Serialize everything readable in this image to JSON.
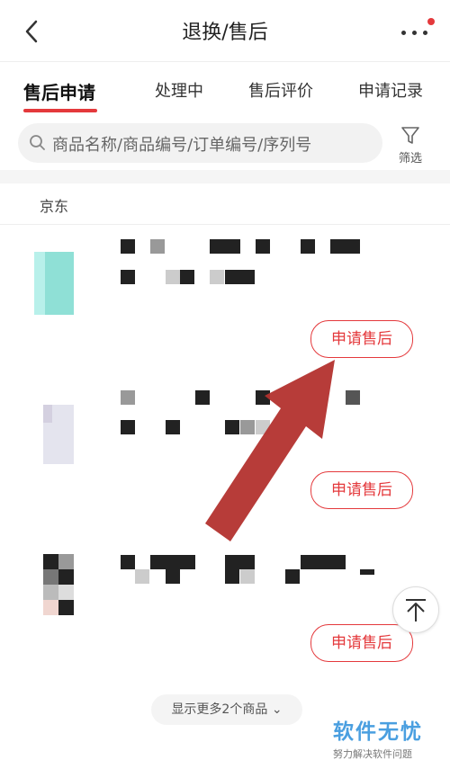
{
  "header": {
    "title": "退换/售后"
  },
  "tabs": [
    {
      "label": "售后申请",
      "active": true
    },
    {
      "label": "处理中"
    },
    {
      "label": "售后评价"
    },
    {
      "label": "申请记录"
    }
  ],
  "search": {
    "placeholder": "商品名称/商品编号/订单编号/序列号",
    "filter_label": "筛选"
  },
  "shop": {
    "name": "京东"
  },
  "products": [
    {
      "action_label": "申请售后"
    },
    {
      "action_label": "申请售后"
    },
    {
      "action_label": "申请售后"
    }
  ],
  "footer": {
    "show_more": "显示更多2个商品",
    "watermark_title": "软件无忧",
    "watermark_subtitle": "努力解决软件问题"
  },
  "colors": {
    "accent": "#e4393c",
    "arrow": "#b3312e",
    "watermark": "#4a9fe0"
  }
}
